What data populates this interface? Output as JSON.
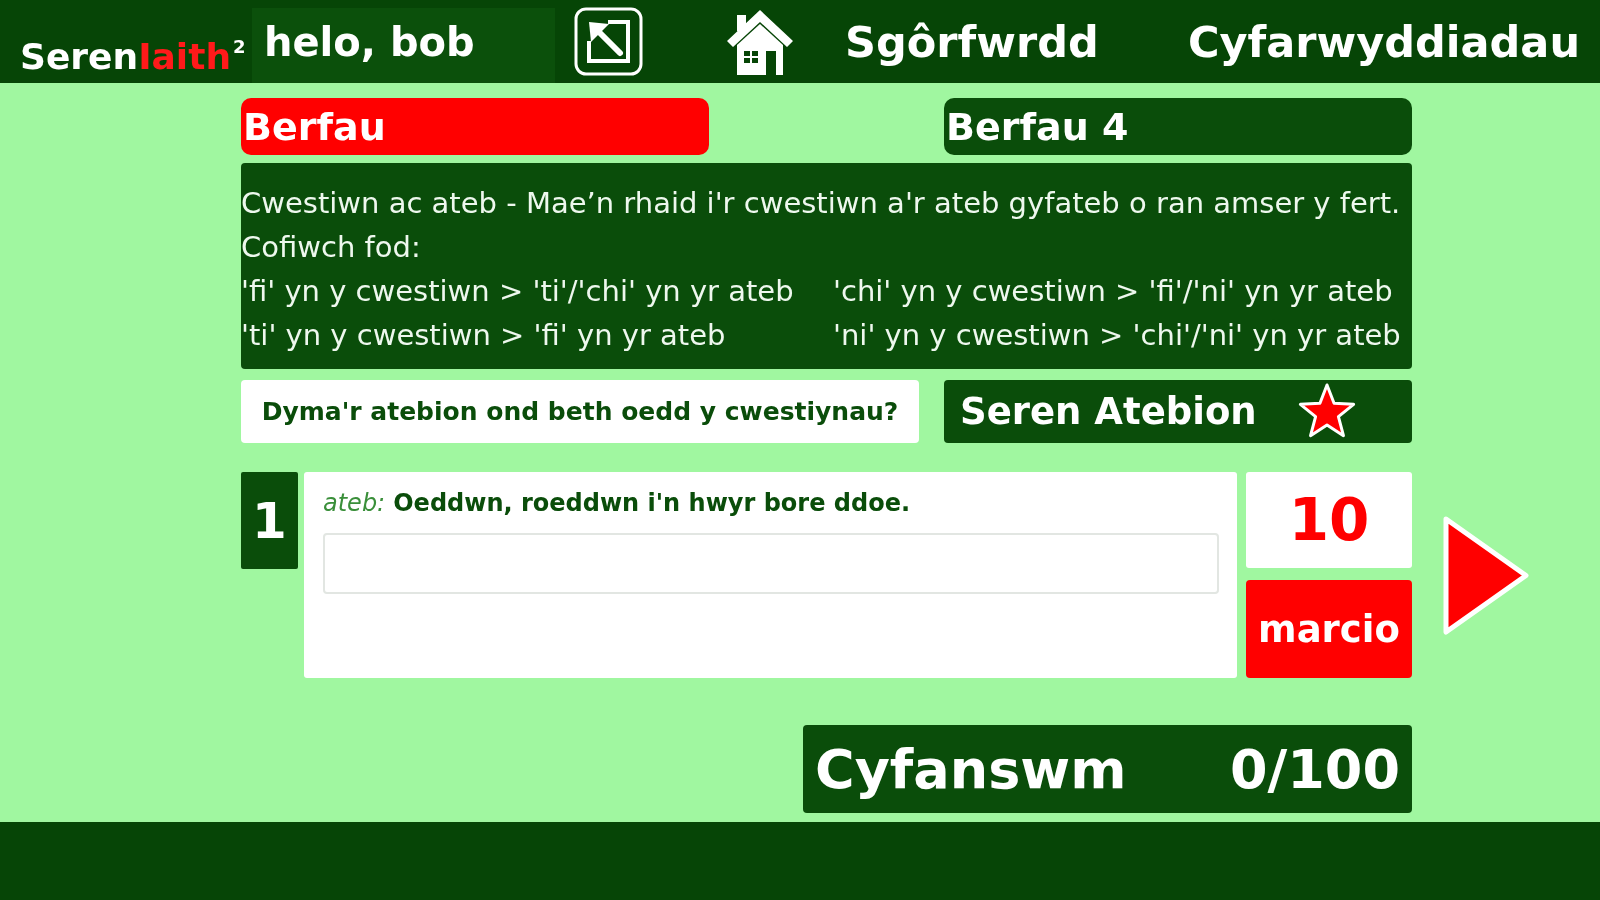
{
  "header": {
    "logo": {
      "main": "Seren",
      "accent": "Iaith",
      "superscript": "2"
    },
    "greeting": "helo, bob",
    "nav": [
      {
        "label": "Sgôrfwrdd"
      },
      {
        "label": "Cyfarwyddiadau"
      }
    ]
  },
  "topic": {
    "label": "Berfau"
  },
  "exercise": {
    "label": "Berfau 4"
  },
  "instructions": {
    "intro": "Cwestiwn ac ateb - Mae’n rhaid i'r cwestiwn a'r ateb gyfateb o ran amser y fert.",
    "note": "Cofiwch fod:",
    "rules": [
      "'fi' yn y cwestiwn > 'ti'/'chi' yn yr ateb",
      "'chi' yn y cwestiwn > 'fi'/'ni' yn yr ateb",
      "'ti' yn y cwestiwn > 'fi' yn yr ateb",
      "'ni' yn y cwestiwn > 'chi'/'ni' yn yr ateb"
    ]
  },
  "prompt": "Dyma'r atebion ond beth oedd y cwestiynau?",
  "star_button": {
    "label": "Seren Atebion"
  },
  "question": {
    "number": "1",
    "answer_label": "ateb:",
    "answer": "Oeddwn, roeddwn i'n hwyr bore ddoe.",
    "points": "10",
    "mark_button": "marcio"
  },
  "total": {
    "label": "Cyfanswm",
    "score": "0/100"
  }
}
